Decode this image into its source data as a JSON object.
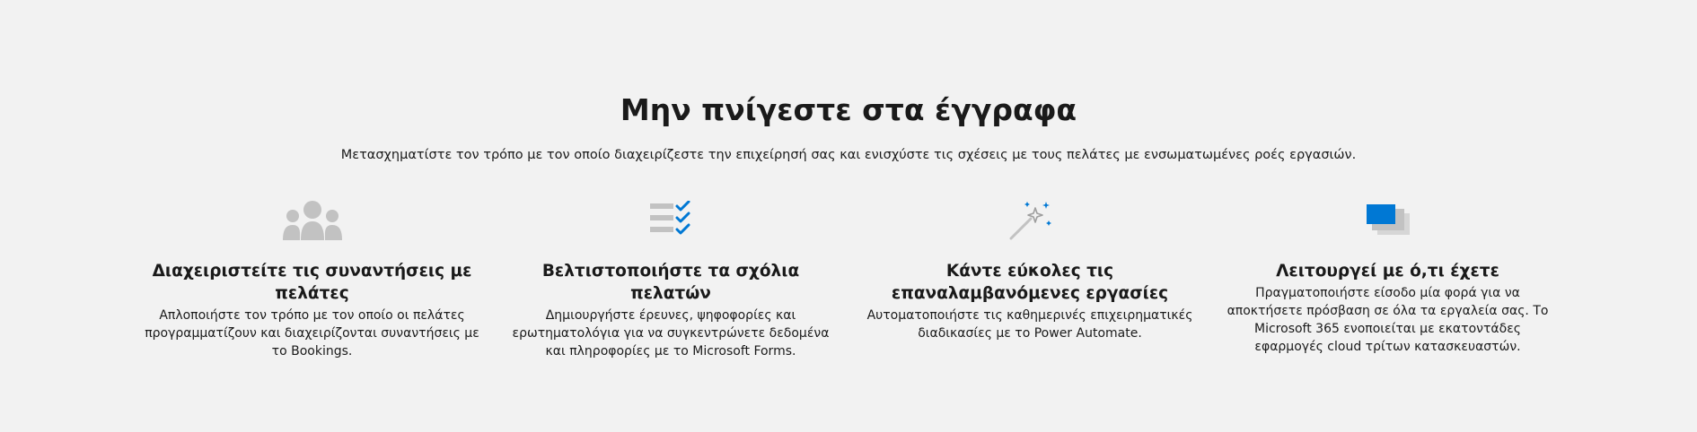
{
  "hero": {
    "title": "Μην πνίγεστε στα έγγραφα",
    "subtitle": "Μετασχηματίστε τον τρόπο με τον οποίο διαχειρίζεστε την επιχείρησή σας και ενισχύστε τις σχέσεις με τους πελάτες με ενσωματωμένες ροές εργασιών."
  },
  "features": [
    {
      "icon": "people-group-icon",
      "title": "Διαχειριστείτε τις συναντήσεις με πελάτες",
      "description": "Απλοποιήστε τον τρόπο με τον οποίο οι πελάτες προγραμματίζουν και διαχειρίζονται συναντήσεις με το Bookings."
    },
    {
      "icon": "checklist-icon",
      "title": "Βελτιστοποιήστε τα σχόλια πελατών",
      "description": "Δημιουργήστε έρευνες, ψηφοφορίες και ερωτηματολόγια για να συγκεντρώνετε δεδομένα και πληροφορίες με το Microsoft Forms."
    },
    {
      "icon": "magic-wand-icon",
      "title": "Κάντε εύκολες τις επαναλαμβανόμενες εργασίες",
      "description": "Αυτοματοποιήστε τις καθημερινές επιχειρηματικές διαδικασίες με το Power Automate."
    },
    {
      "icon": "stacked-windows-icon",
      "title": "Λειτουργεί με ό,τι έχετε",
      "description": "Πραγματοποιήστε είσοδο μία φορά για να αποκτήσετε πρόσβαση σε όλα τα εργαλεία σας. Το Microsoft 365 ενοποιείται με εκατοντάδες εφαρμογές cloud τρίτων κατασκευαστών."
    }
  ],
  "colors": {
    "background": "#f2f2f2",
    "icon_gray": "#c2c2c2",
    "accent_blue": "#0078d4",
    "text": "#1a1a1a"
  }
}
